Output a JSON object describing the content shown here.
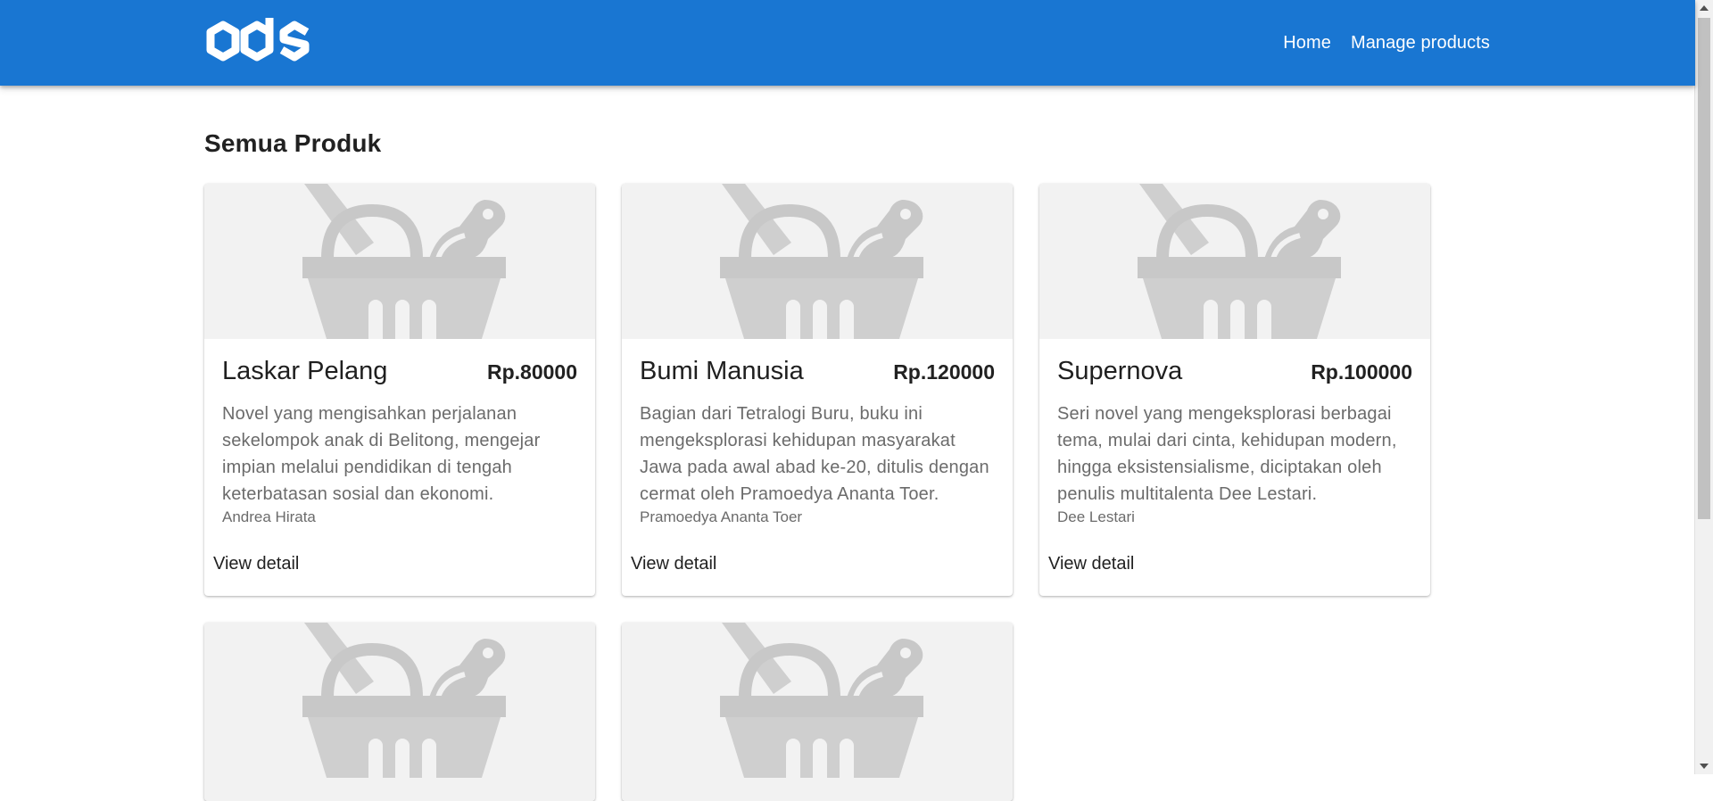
{
  "header": {
    "logo_icon": "ads-logo-icon",
    "nav": [
      {
        "label": "Home"
      },
      {
        "label": "Manage products"
      }
    ],
    "color": "#1976d2"
  },
  "main": {
    "title": "Semua Produk",
    "products": [
      {
        "image_icon": "shopping-basket-icon",
        "title": "Laskar Pelang",
        "price": "Rp.80000",
        "description": "Novel yang mengisahkan perjalanan sekelompok anak di Belitong, mengejar impian melalui pendidikan di tengah keterbatasan sosial dan ekonomi.",
        "author": "Andrea Hirata",
        "action": "View detail"
      },
      {
        "image_icon": "shopping-basket-icon",
        "title": "Bumi Manusia",
        "price": "Rp.120000",
        "description": "Bagian dari Tetralogi Buru, buku ini mengeksplorasi kehidupan masyarakat Jawa pada awal abad ke-20, ditulis dengan cermat oleh Pramoedya Ananta Toer.",
        "author": "Pramoedya Ananta Toer",
        "action": "View detail"
      },
      {
        "image_icon": "shopping-basket-icon",
        "title": "Supernova",
        "price": "Rp.100000",
        "description": "Seri novel yang mengeksplorasi berbagai tema, mulai dari cinta, kehidupan modern, hingga eksistensialisme, diciptakan oleh penulis multitalenta Dee Lestari.",
        "author": "Dee Lestari",
        "action": "View detail"
      }
    ],
    "partial_cards": [
      {
        "image_icon": "shopping-basket-icon"
      },
      {
        "image_icon": "shopping-basket-icon"
      }
    ]
  }
}
